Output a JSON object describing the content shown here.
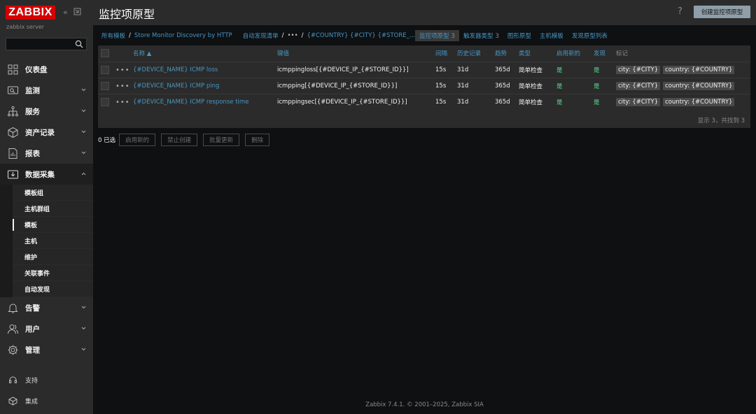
{
  "sidebar": {
    "logo": "ZABBIX",
    "server_name": "zabbix server",
    "search_placeholder": "",
    "nav": [
      {
        "label": "仪表盘",
        "icon": "dashboard-icon"
      },
      {
        "label": "监测",
        "icon": "monitoring-icon"
      },
      {
        "label": "服务",
        "icon": "services-icon"
      },
      {
        "label": "资产记录",
        "icon": "inventory-icon"
      },
      {
        "label": "报表",
        "icon": "reports-icon"
      },
      {
        "label": "数据采集",
        "icon": "data-collection-icon"
      },
      {
        "label": "告警",
        "icon": "alerts-icon"
      },
      {
        "label": "用户",
        "icon": "users-icon"
      },
      {
        "label": "管理",
        "icon": "administration-icon"
      }
    ],
    "sub_items": [
      "模板组",
      "主机群组",
      "模板",
      "主机",
      "维护",
      "关联事件",
      "自动发现"
    ],
    "bottom": [
      {
        "label": "支持",
        "icon": "support-icon"
      },
      {
        "label": "集成",
        "icon": "integrations-icon"
      }
    ]
  },
  "header": {
    "title": "监控项原型",
    "help": "?",
    "create_button": "创建监控项原型"
  },
  "breadcrumbs": {
    "all_templates": "所有模板",
    "sep": "/",
    "template": "Store Monitor Discovery by HTTP",
    "discovery_list": "自动发现清单",
    "ellipsis": "•••",
    "rule": "{#COUNTRY} {#CITY} {#STORE_..."
  },
  "tabs": [
    {
      "label": "监控项原型",
      "count": "3",
      "active": true
    },
    {
      "label": "触发器类型",
      "count": "3"
    },
    {
      "label": "图形原型",
      "count": ""
    },
    {
      "label": "主机模板",
      "count": ""
    },
    {
      "label": "发现原型列表",
      "count": ""
    }
  ],
  "table": {
    "columns": {
      "name": "名称 ▲",
      "key": "键值",
      "interval": "间隔",
      "history": "历史记录",
      "trends": "趋势",
      "type": "类型",
      "create_enabled": "启用新的",
      "discover": "发现",
      "tags": "标记"
    },
    "rows": [
      {
        "dots": "•••",
        "name": "{#DEVICE_NAME} ICMP loss",
        "key": "icmppingloss[{#DEVICE_IP_{#STORE_ID}}]",
        "interval": "15s",
        "history": "31d",
        "trends": "365d",
        "type": "简单检查",
        "create_enabled": "是",
        "discover": "是",
        "tags": [
          "city: {#CITY}",
          "country: {#COUNTRY}"
        ]
      },
      {
        "dots": "•••",
        "name": "{#DEVICE_NAME} ICMP ping",
        "key": "icmpping[{#DEVICE_IP_{#STORE_ID}}]",
        "interval": "15s",
        "history": "31d",
        "trends": "365d",
        "type": "简单检查",
        "create_enabled": "是",
        "discover": "是",
        "tags": [
          "city: {#CITY}",
          "country: {#COUNTRY}"
        ]
      },
      {
        "dots": "•••",
        "name": "{#DEVICE_NAME} ICMP response time",
        "key": "icmppingsec[{#DEVICE_IP_{#STORE_ID}}]",
        "interval": "15s",
        "history": "31d",
        "trends": "365d",
        "type": "简单检查",
        "create_enabled": "是",
        "discover": "是",
        "tags": [
          "city: {#CITY}",
          "country: {#COUNTRY}"
        ]
      }
    ],
    "footer": "显示 3，共找到 3"
  },
  "mass_actions": {
    "selected": "0 已选",
    "enable": "启用新的",
    "disable": "禁止创建",
    "mass_update": "批量更新",
    "delete": "删除"
  },
  "copyright": "Zabbix 7.4.1. © 2001–2025, Zabbix SIA",
  "colors": {
    "brand": "#d40000",
    "link": "#4796c4",
    "success": "#59db8f",
    "sidebar": "#2b2b2b",
    "background": "#0e1012"
  }
}
